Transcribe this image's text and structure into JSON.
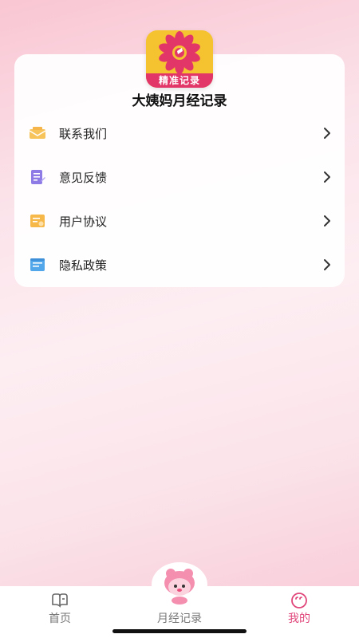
{
  "app": {
    "name": "大姨妈月经记录",
    "logo_caption": "精准记录",
    "logo_bg": "#f5c330",
    "logo_accent": "#e23668"
  },
  "menu": [
    {
      "label": "联系我们",
      "icon": "mail-icon",
      "color": "#f5b54a"
    },
    {
      "label": "意见反馈",
      "icon": "feedback-icon",
      "color": "#8f7be6"
    },
    {
      "label": "用户协议",
      "icon": "agreement-icon",
      "color": "#f7b84a"
    },
    {
      "label": "隐私政策",
      "icon": "privacy-icon",
      "color": "#52a6ea"
    }
  ],
  "tabs": [
    {
      "label": "首页",
      "icon": "home-tab-icon",
      "active": false
    },
    {
      "label": "月经记录",
      "icon": "mascot-icon",
      "active": false
    },
    {
      "label": "我的",
      "icon": "profile-tab-icon",
      "active": true
    }
  ],
  "colors": {
    "active_tab": "#e0457a",
    "inactive_tab": "#777777"
  }
}
